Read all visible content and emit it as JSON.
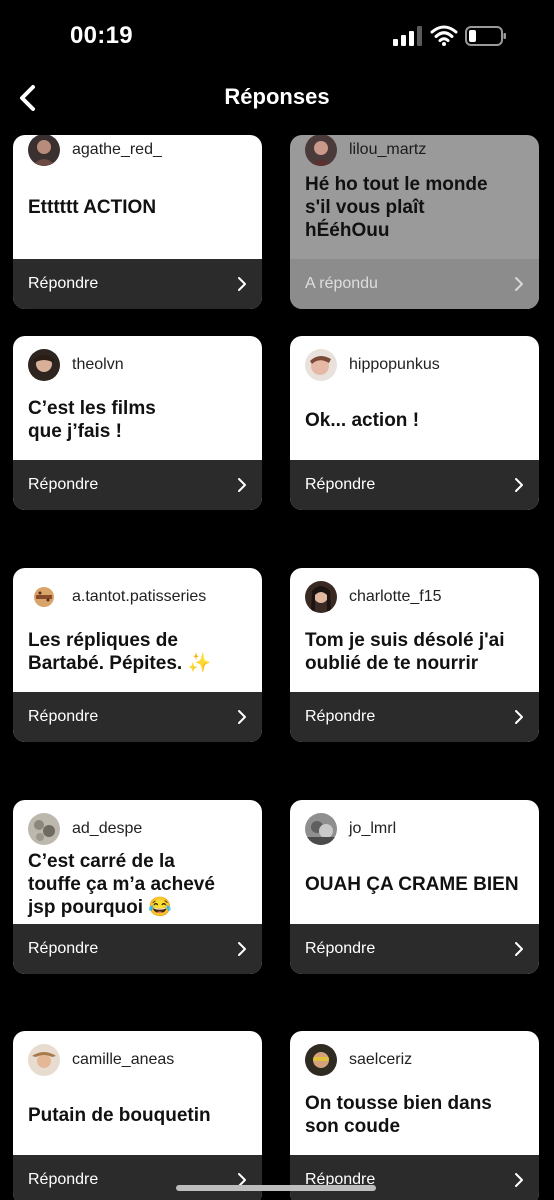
{
  "status_bar": {
    "time": "00:19"
  },
  "nav": {
    "title": "Réponses"
  },
  "cta_reply": "Répondre",
  "cards": [
    {
      "username": "agathe_red_",
      "message": "Etttttt ACTION",
      "cta": "Répondre",
      "answered": false
    },
    {
      "username": "lilou_martz",
      "message": "Hé ho tout le monde\ns'il vous plaît\nhÉéhOuu",
      "cta": "A répondu",
      "answered": true
    },
    {
      "username": "theolvn",
      "message": "C’est les films\nque j’fais !",
      "cta": "Répondre",
      "answered": false
    },
    {
      "username": "hippopunkus",
      "message": "Ok... action !",
      "cta": "Répondre",
      "answered": false
    },
    {
      "username": "a.tantot.patisseries",
      "message": "Les répliques de\nBartabé. Pépites. ✨",
      "cta": "Répondre",
      "answered": false
    },
    {
      "username": "charlotte_f15",
      "message": "Tom je suis désolé j'ai\noublié de te nourrir",
      "cta": "Répondre",
      "answered": false
    },
    {
      "username": "ad_despe",
      "message": "C’est carré de la\ntouffe ça m’a achevé\njsp pourquoi 😂",
      "cta": "Répondre",
      "answered": false
    },
    {
      "username": "jo_lmrl",
      "message": "OUAH ÇA CRAME BIEN",
      "cta": "Répondre",
      "answered": false
    },
    {
      "username": "camille_aneas",
      "message": "Putain de bouquetin",
      "cta": "Répondre",
      "answered": false
    },
    {
      "username": "saelceriz",
      "message": "On tousse bien dans\nson coude",
      "cta": "Répondre",
      "answered": false
    }
  ],
  "colors": {
    "background": "#000000",
    "card": "#ffffff",
    "card_answered": "#9a9a9a",
    "cta_bar": "#2b2b2b"
  },
  "icons": [
    "back-chevron-icon",
    "signal-icon",
    "wifi-icon",
    "battery-icon",
    "chevron-right-icon"
  ]
}
